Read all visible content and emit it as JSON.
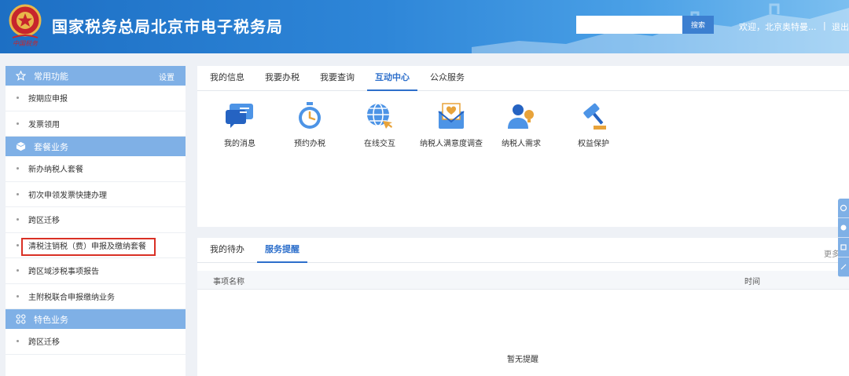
{
  "header": {
    "site_title": "国家税务总局北京市电子税务局",
    "search_button": "搜索",
    "welcome_text": "欢迎，北京奥特曼...",
    "separator": "|",
    "logout": "退出",
    "emblem_text": "中国税务"
  },
  "sidebar": {
    "sections": [
      {
        "title": "常用功能",
        "settings": "设置",
        "items": [
          "按期应申报",
          "发票领用"
        ]
      },
      {
        "title": "套餐业务",
        "items": [
          "新办纳税人套餐",
          "初次申领发票快捷办理",
          "跨区迁移",
          "清税注销税（费）申报及缴纳套餐",
          "跨区域涉税事项报告",
          "主附税联合申报缴纳业务"
        ]
      },
      {
        "title": "特色业务",
        "items": [
          "跨区迁移"
        ]
      }
    ]
  },
  "main": {
    "tabs": [
      "我的信息",
      "我要办税",
      "我要查询",
      "互动中心",
      "公众服务"
    ],
    "active_tab": "互动中心",
    "grid": [
      {
        "label": "我的消息",
        "icon": "message-icon"
      },
      {
        "label": "预约办税",
        "icon": "stopwatch-icon"
      },
      {
        "label": "在线交互",
        "icon": "globe-icon"
      },
      {
        "label": "纳税人满意度调查",
        "icon": "survey-envelope-icon"
      },
      {
        "label": "纳税人需求",
        "icon": "user-idea-icon"
      },
      {
        "label": "权益保护",
        "icon": "gavel-icon"
      }
    ]
  },
  "bottom": {
    "tabs": [
      "我的待办",
      "服务提醒"
    ],
    "active_tab": "服务提醒",
    "more": "更多",
    "columns": [
      "事项名称",
      "时间"
    ],
    "empty_text": "暂无提醒"
  },
  "colors": {
    "accent": "#2d6fcb",
    "sidebar_header": "#7fb0e6",
    "highlight_border": "#d93025"
  }
}
